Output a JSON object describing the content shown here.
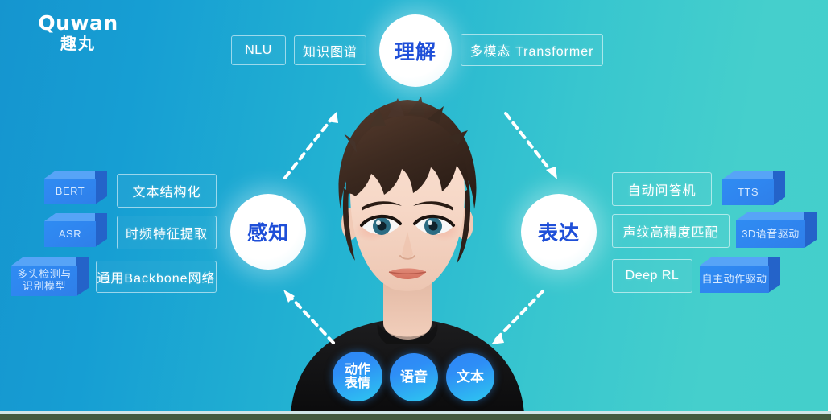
{
  "brand": {
    "mark": "Quwan",
    "cn": "趣丸"
  },
  "colors": {
    "bg_left": "#1595cf",
    "bg_right": "#45cfcc",
    "accent_blue": "#2f86f0",
    "hub_text": "#1f4fd8",
    "tag_border": "rgba(255,255,255,0.55)",
    "bottom_strip": "#435a3f"
  },
  "hubs": {
    "understand": "理解",
    "perceive": "感知",
    "express": "表达"
  },
  "top_row": {
    "tags": [
      {
        "label": "NLU",
        "type": "outline"
      },
      {
        "label": "知识图谱",
        "type": "outline"
      },
      {
        "label": "多模态 Transformer",
        "type": "outline"
      }
    ]
  },
  "left_column": {
    "cubes": [
      {
        "label": "BERT"
      },
      {
        "label": "ASR"
      },
      {
        "label_line1": "多头检测与",
        "label_line2": "识别模型"
      }
    ],
    "tags": [
      {
        "label": "文本结构化"
      },
      {
        "label": "时频特征提取"
      },
      {
        "label": "通用Backbone网络"
      }
    ]
  },
  "right_column": {
    "tags": [
      {
        "label": "自动问答机"
      },
      {
        "label": "声纹高精度匹配"
      },
      {
        "label": "Deep RL"
      }
    ],
    "cubes": [
      {
        "label": "TTS"
      },
      {
        "label": "3D语音驱动"
      },
      {
        "label": "自主动作驱动"
      }
    ]
  },
  "modalities": [
    {
      "line1": "动作",
      "line2": "表情"
    },
    {
      "line1": "语音",
      "line2": ""
    },
    {
      "line1": "文本",
      "line2": ""
    }
  ],
  "avatar": {
    "description": "3D虚拟人"
  },
  "flow_arrows": [
    {
      "name": "perceive-to-understand",
      "direction": "up-right"
    },
    {
      "name": "understand-to-express",
      "direction": "down-right"
    },
    {
      "name": "modality-to-perceive",
      "direction": "up-left"
    },
    {
      "name": "express-to-modality",
      "direction": "down-left"
    }
  ]
}
